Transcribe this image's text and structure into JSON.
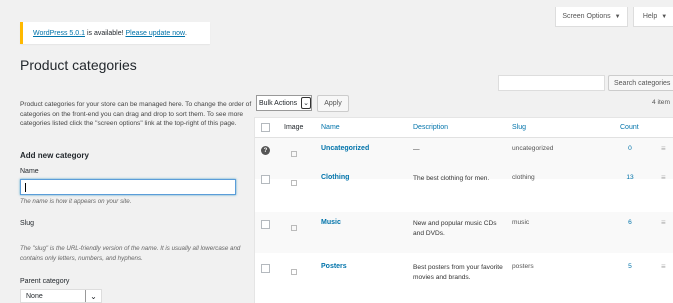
{
  "screen_options": {
    "label": "Screen Options",
    "help_label": "Help"
  },
  "notice": {
    "version_text": "WordPress 5.0.1",
    "middle_text": " is available! ",
    "update_link": "Please update now",
    "end_text": "."
  },
  "page": {
    "title": "Product categories"
  },
  "search": {
    "button": "Search categories",
    "value": ""
  },
  "left": {
    "description": "Product categories for your store can be managed here. To change the order of categories on the front-end you can drag and drop to sort them. To see more categories listed click the \"screen options\" link at the top-right of this page.",
    "add_heading": "Add new category",
    "name_label": "Name",
    "name_hint": "The name is how it appears on your site.",
    "slug_label": "Slug",
    "slug_hint": "The \"slug\" is the URL-friendly version of the name. It is usually all lowercase and contains only letters, numbers, and hyphens.",
    "parent_label": "Parent category",
    "parent_value": "None"
  },
  "bulk": {
    "label": "Bulk Actions",
    "apply": "Apply",
    "items_count": "4 item"
  },
  "table": {
    "headers": {
      "image": "Image",
      "name": "Name",
      "description": "Description",
      "slug": "Slug",
      "count": "Count"
    },
    "rows": [
      {
        "name": "Uncategorized",
        "description": "—",
        "slug": "uncategorized",
        "count": "0",
        "info": "?"
      },
      {
        "name": "Clothing",
        "description": "The best clothing for men.",
        "slug": "clothing",
        "count": "13"
      },
      {
        "name": "Music",
        "description": "New and popular music CDs and DVDs.",
        "slug": "music",
        "count": "6"
      },
      {
        "name": "Posters",
        "description": "Best posters from your favorite movies and brands.",
        "slug": "posters",
        "count": "5"
      }
    ]
  },
  "icons": {
    "drag": "drag-handle-icon",
    "caret": "caret-down-icon",
    "image_placeholder": "image-placeholder-icon",
    "info": "info-icon"
  },
  "colors": {
    "link": "#0073aa",
    "notice_border": "#ffb900",
    "background": "#f1f1f1"
  }
}
